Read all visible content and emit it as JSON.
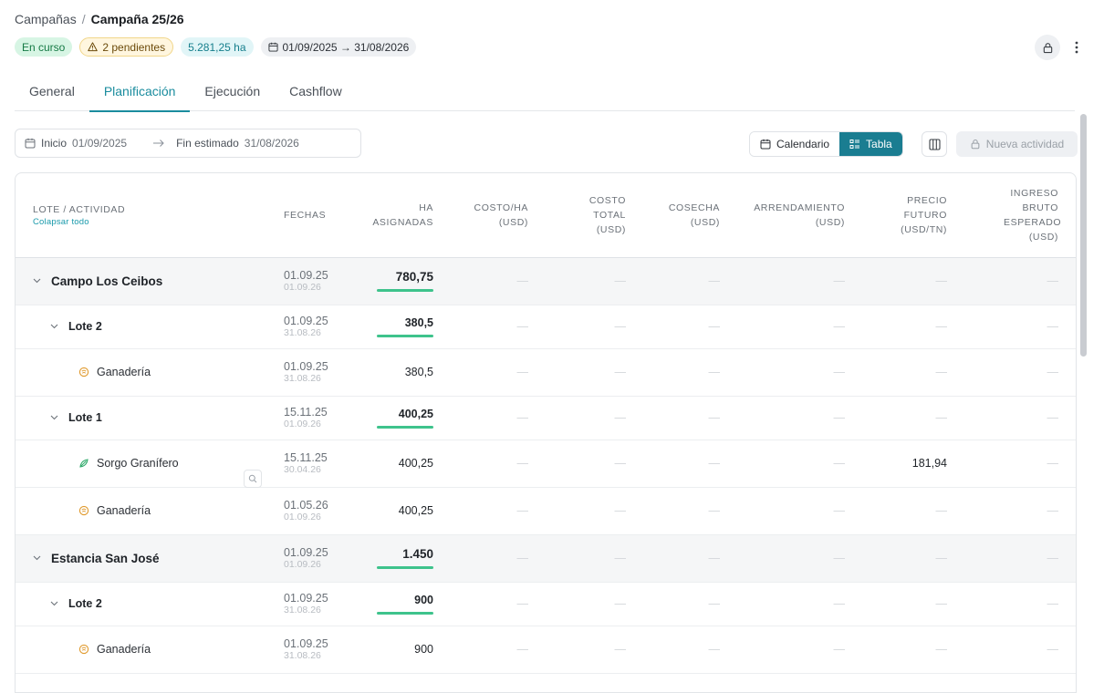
{
  "breadcrumb": {
    "root": "Campañas",
    "separator": "/",
    "current": "Campaña 25/26"
  },
  "badges": {
    "status": "En curso",
    "pending": "2 pendientes",
    "hectares": "5.281,25 ha",
    "dates": "01/09/2025 → 31/08/2026"
  },
  "tabs": [
    "General",
    "Planificación",
    "Ejecución",
    "Cashflow"
  ],
  "toolbar": {
    "start_label": "Inicio",
    "start_value": "01/09/2025",
    "end_label": "Fin estimado",
    "end_value": "31/08/2026",
    "view_calendar": "Calendario",
    "view_table": "Tabla",
    "new_activity": "Nueva actividad"
  },
  "table": {
    "header_lote": "Lote / Actividad",
    "collapse_all": "Colapsar todo",
    "header_fechas": "Fechas",
    "header_ha": "Ha asignadas",
    "header_costo_ha": "Costo/ha (USD)",
    "header_costo_total": "Costo total (USD)",
    "header_cosecha": "Cosecha (USD)",
    "header_arrendamiento": "Arrendamiento (USD)",
    "header_precio_futuro": "Precio futuro (USD/TN)",
    "header_ingreso": "Ingreso bruto esperado (USD)",
    "dash": "—",
    "rows": [
      {
        "type": "campo",
        "name": "Campo Los Ceibos",
        "d1": "01.09.25",
        "d2": "01.09.26",
        "ha": "780,75",
        "precio": ""
      },
      {
        "type": "lote",
        "name": "Lote 2",
        "d1": "01.09.25",
        "d2": "31.08.26",
        "ha": "380,5",
        "precio": ""
      },
      {
        "type": "act",
        "icon": "livestock",
        "name": "Ganadería",
        "d1": "01.09.25",
        "d2": "31.08.26",
        "ha": "380,5",
        "precio": ""
      },
      {
        "type": "lote",
        "name": "Lote 1",
        "d1": "15.11.25",
        "d2": "01.09.26",
        "ha": "400,25",
        "precio": ""
      },
      {
        "type": "act",
        "icon": "crop",
        "name": "Sorgo Granífero",
        "d1": "15.11.25",
        "d2": "30.04.26",
        "ha": "400,25",
        "precio": "181,94"
      },
      {
        "type": "act",
        "icon": "livestock",
        "name": "Ganadería",
        "d1": "01.05.26",
        "d2": "01.09.26",
        "ha": "400,25",
        "precio": ""
      },
      {
        "type": "campo",
        "name": "Estancia San José",
        "d1": "01.09.25",
        "d2": "01.09.26",
        "ha": "1.450",
        "precio": ""
      },
      {
        "type": "lote",
        "name": "Lote 2",
        "d1": "01.09.25",
        "d2": "31.08.26",
        "ha": "900",
        "precio": ""
      },
      {
        "type": "act",
        "icon": "livestock",
        "name": "Ganadería",
        "d1": "01.09.25",
        "d2": "31.08.26",
        "ha": "900",
        "precio": ""
      }
    ]
  },
  "colors": {
    "accent": "#1a8c9e",
    "ha_bar": "#3ec38c",
    "status_bg": "#d7f5e4",
    "warn_border": "#f1d68a"
  }
}
